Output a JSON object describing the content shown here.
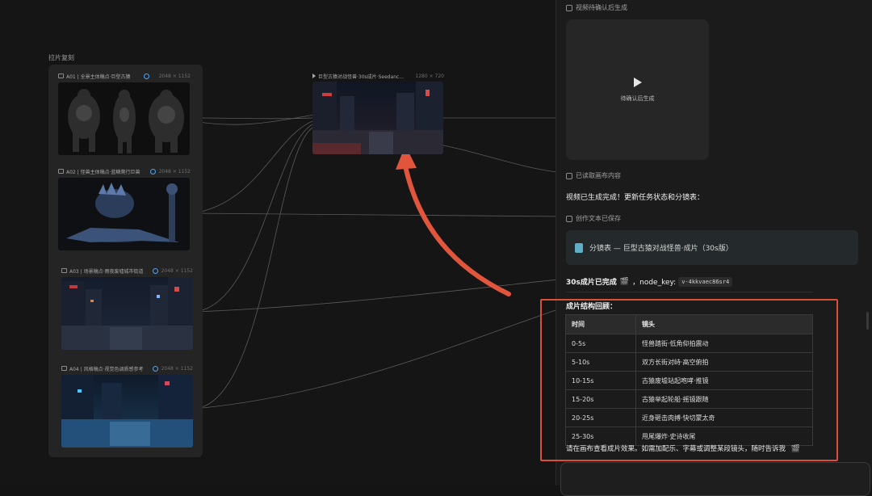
{
  "canvas": {
    "group_title": "拉片复刻",
    "cards": [
      {
        "title": "A01 | 全景主体稿点·巨型古猿",
        "dims": "2048 × 1152",
        "verified": true
      },
      {
        "title": "A02 | 怪兽主体稿点·蓝鳞爬行巨兽",
        "dims": "2048 × 1152",
        "verified": true
      },
      {
        "title": "A03 | 场景稿点·雨夜废墟城市街道",
        "dims": "2048 × 1152",
        "verified": true
      },
      {
        "title": "A04 | 风格稿点·视觉色调质感参考",
        "dims": "2048 × 1152",
        "verified": true
      }
    ],
    "output": {
      "title": "巨型古猿对战怪兽·30s成片·Seedanc...",
      "dims": "1280 × 720"
    }
  },
  "sidebar": {
    "video_pending_label": "视频待确认后生成",
    "video_placeholder": "待确认后生成",
    "canvas_read_label": "已读取画布内容",
    "status_msg": "视频已生成完成！更新任务状态和分镜表：",
    "saved_label": "创作文本已保存",
    "doc_label": "分镜表 — 巨型古猿对战怪兽·成片（30s版）",
    "done_text": "30s成片已完成",
    "node_key_label": "，node_key:",
    "node_key": "v-4kkvaec86sr4",
    "review_title": "成片结构回顾：",
    "table": {
      "headers": [
        "时间",
        "镜头"
      ],
      "rows": [
        [
          "0-5s",
          "怪兽踏街·低角仰拍震动"
        ],
        [
          "5-10s",
          "双方长街对峙·高空俯拍"
        ],
        [
          "10-15s",
          "古猿废墟站起咆哮·推镜"
        ],
        [
          "15-20s",
          "古猿举起轮船·摇镜跟随"
        ],
        [
          "20-25s",
          "近身砸击肉搏·快切蒙太奇"
        ],
        [
          "25-30s",
          "甩尾爆炸·史诗收尾"
        ]
      ]
    },
    "footer_msg": "请在画布查看成片效果。如需加配乐、字幕或调整某段镜头，随时告诉我"
  },
  "colors": {
    "highlight": "#d9503a",
    "arrow": "#e0553c",
    "accent_blue": "#4aa3ff",
    "clapper": "#b47cff"
  },
  "icons": [
    "image-icon",
    "verified-badge-icon",
    "play-icon",
    "edit-icon",
    "document-icon",
    "clapperboard-icon"
  ]
}
